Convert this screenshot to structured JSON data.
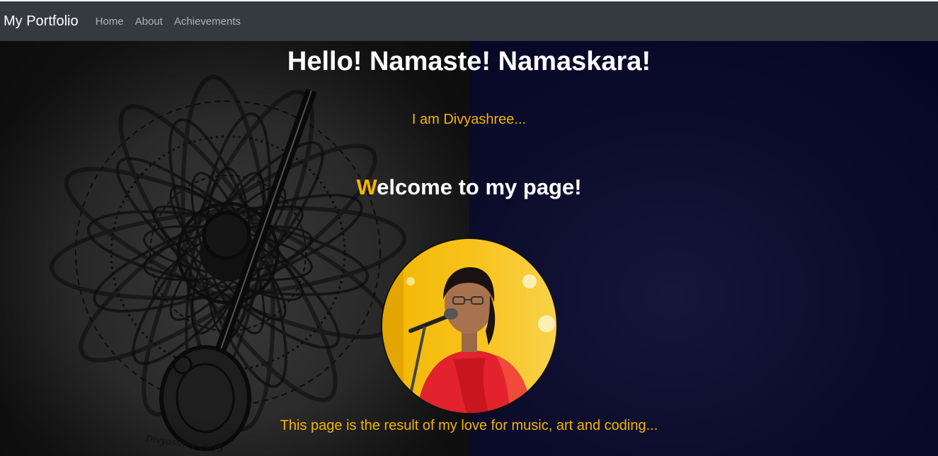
{
  "navbar": {
    "brand": "My Portfolio",
    "links": [
      "Home",
      "About",
      "Achievements"
    ]
  },
  "hero": {
    "title": "Hello! Namaste! Namaskara!",
    "subtitle": "I am Divyashree...",
    "welcome_first_letter": "W",
    "welcome_rest": "elcome to my page!",
    "tagline": "This page is the result of my love for music, art and coding...",
    "artwork_signature": "Divyashree 2019"
  },
  "colors": {
    "navbar_bg": "#343a40",
    "accent": "#f5b301",
    "hero_bg": "#020224"
  }
}
